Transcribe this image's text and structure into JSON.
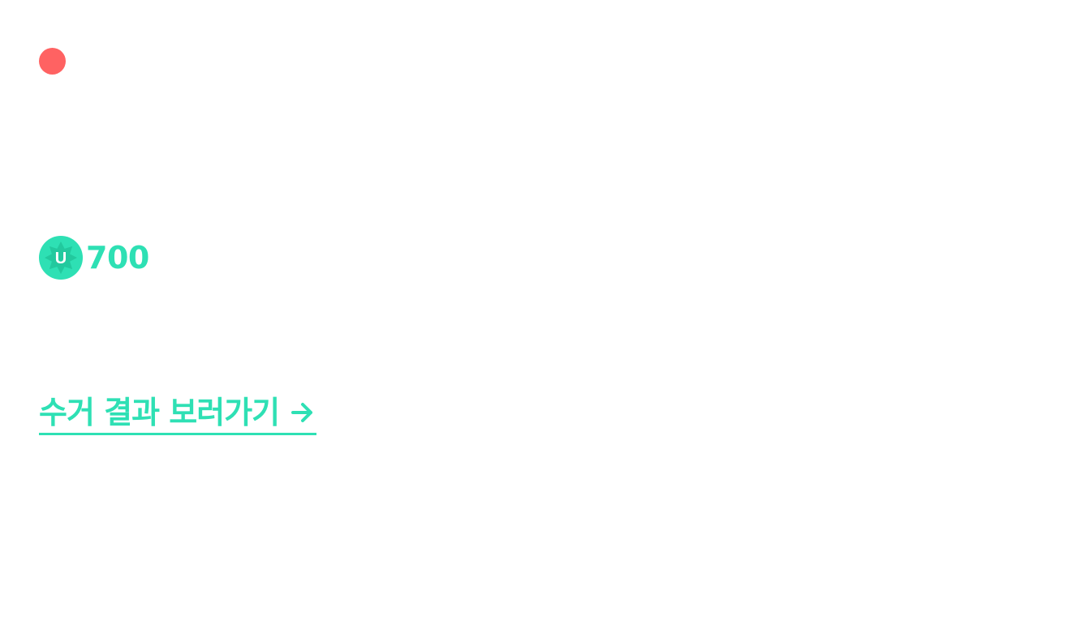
{
  "colors": {
    "accent": "#2ee0b4",
    "status_dot": "#ff6262",
    "background": "#ffffff"
  },
  "status": {
    "icon": "red-dot-indicator"
  },
  "points": {
    "badge_letter": "U",
    "value": "700",
    "icon": "u-coin-icon"
  },
  "result_link": {
    "label": "수거 결과 보러가기",
    "icon": "arrow-right-icon"
  }
}
